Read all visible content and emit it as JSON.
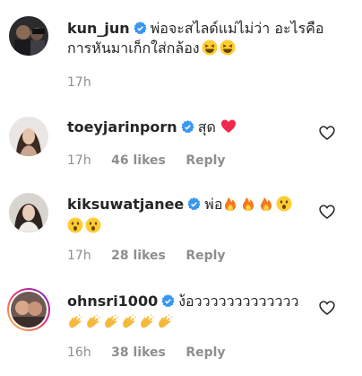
{
  "comments": [
    {
      "username": "kun_jun",
      "text_line1": "พ่อจะสไลด์แม่ไม่ว่า อะไรคือ",
      "text_line2": "การหันมาเก็กใส่กล้อง",
      "time": "17h",
      "likes": "",
      "reply": "",
      "avatar_icon": "avatar-photo"
    },
    {
      "username": "toeyjarinporn",
      "text_line1": "สุด",
      "time": "17h",
      "likes": "46 likes",
      "reply": "Reply",
      "avatar_icon": "avatar-photo"
    },
    {
      "username": "kiksuwatjanee",
      "text_line1": "พ่อ",
      "time": "17h",
      "likes": "28 likes",
      "reply": "Reply",
      "avatar_icon": "avatar-photo"
    },
    {
      "username": "ohnsri1000",
      "text_line1": "ง้อววววววววววววว",
      "time": "16h",
      "likes": "38 likes",
      "reply": "Reply",
      "avatar_icon": "avatar-photo-story-ring"
    }
  ],
  "colors": {
    "verified_blue": "#3897f0",
    "meta_gray": "#8e8e8e",
    "heart_red": "#ed2a4b",
    "fire_orange": "#f5781e"
  }
}
